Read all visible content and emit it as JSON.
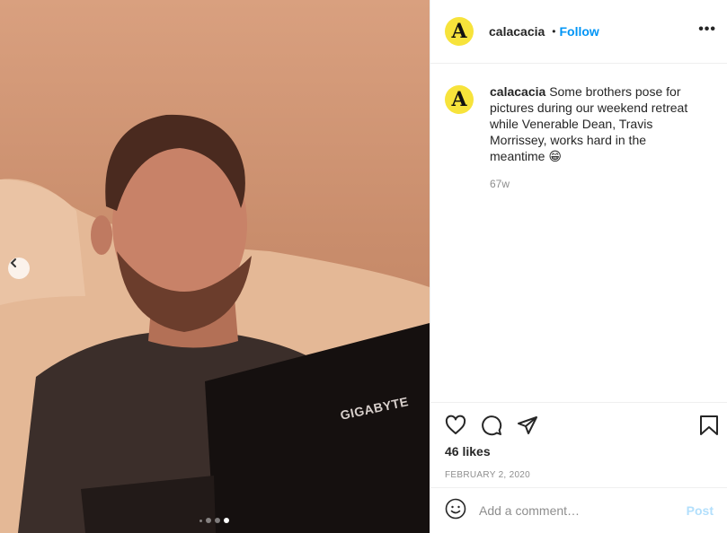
{
  "post": {
    "username": "calacacia",
    "avatar_letter": "A",
    "follow_label": "Follow",
    "separator": "•",
    "more_label": "•••",
    "caption_text": "Some brothers pose for pictures during our weekend retreat while Venerable Dean, Travis Morrissey, works hard in the meantime 😁",
    "time_ago": "67w",
    "likes": "46 likes",
    "date": "FEBRUARY 2, 2020",
    "laptop_brand": "GIGABYTE"
  },
  "carousel": {
    "slide_count": 3,
    "active_index": 3
  },
  "comment": {
    "placeholder": "Add a comment…",
    "post_label": "Post"
  },
  "colors": {
    "accent": "#0095f6",
    "avatar_bg": "#f7e33b",
    "post_disabled": "#b2dffc",
    "muted": "#8e8e8e"
  },
  "icons": [
    "chevron-left-icon",
    "more-icon",
    "heart-icon",
    "comment-icon",
    "share-icon",
    "bookmark-icon",
    "emoji-icon"
  ]
}
